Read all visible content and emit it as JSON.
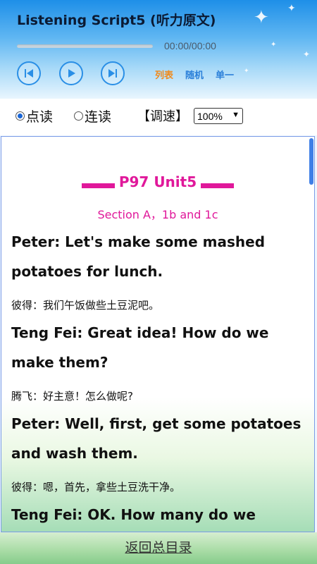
{
  "header": {
    "title": "Listening Script5 (听力原文)",
    "time": "00:00/00:00",
    "progress": 0,
    "controls": {
      "prev_icon": "skip-previous-icon",
      "play_icon": "play-icon",
      "next_icon": "skip-next-icon"
    },
    "modes": [
      {
        "label": "列表",
        "color": "#f08a1c"
      },
      {
        "label": "随机",
        "color": "#2a7fd9"
      },
      {
        "label": "单一",
        "color": "#2a7fd9"
      }
    ]
  },
  "options": {
    "radio1": "点读",
    "radio2": "连读",
    "selected": "点读",
    "speed_label": "【调速】",
    "speed_value": "100%"
  },
  "content": {
    "heading": "P97 Unit5",
    "subheading": "Section A，1b and 1c",
    "lines": [
      {
        "en": "Peter: Let's make some mashed potatoes for lunch.",
        "zh": "彼得：我们午饭做些土豆泥吧。"
      },
      {
        "en": "Teng Fei: Great idea! How do we make them?",
        "zh": "腾飞：好主意！怎么做呢?"
      },
      {
        "en": "Peter: Well, first, get some potatoes and wash them.",
        "zh": "彼得：嗯，首先，拿些土豆洗干净。"
      },
      {
        "en": "Teng Fei: OK. How many do we need?",
        "zh": ""
      }
    ]
  },
  "footer": {
    "back_link": "返回总目录"
  },
  "colors": {
    "accent": "#e0189a",
    "control_blue": "#2a8fe6"
  }
}
